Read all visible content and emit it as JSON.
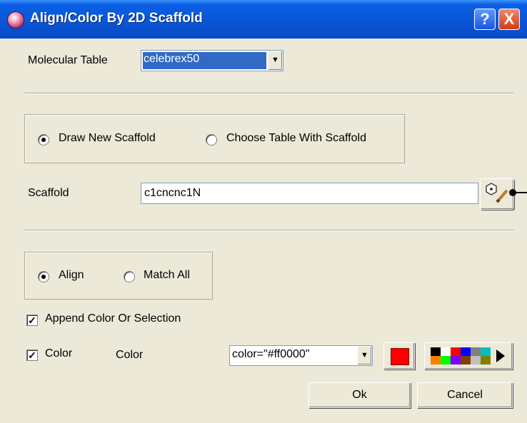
{
  "window": {
    "title": "Align/Color By 2D Scaffold"
  },
  "title_buttons": {
    "help": "?",
    "close": "X"
  },
  "table": {
    "label": "Molecular Table",
    "selected": "celebrex50"
  },
  "scaffold_mode": {
    "options": [
      {
        "label": "Draw New Scaffold",
        "selected": true
      },
      {
        "label": "Choose Table With Scaffold",
        "selected": false
      }
    ]
  },
  "scaffold": {
    "label": "Scaffold",
    "value": "c1cncnc1N"
  },
  "align_mode": {
    "options": [
      {
        "label": "Align",
        "selected": true
      },
      {
        "label": "Match All",
        "selected": false
      }
    ]
  },
  "append": {
    "label": "Append Color Or Selection",
    "checked": true
  },
  "color": {
    "checkbox_label": "Color",
    "label": "Color",
    "selected": "color=\"#ff0000\"",
    "swatch": "#ff0000"
  },
  "palette_colors": [
    "#000000",
    "#ffffff",
    "#ff0000",
    "#0000ff",
    "#808080",
    "#00c0c0",
    "#ff8000",
    "#00ff00",
    "#8000ff",
    "#804000",
    "#c0c0c0",
    "#808000"
  ],
  "buttons": {
    "ok": "Ok",
    "cancel": "Cancel"
  }
}
